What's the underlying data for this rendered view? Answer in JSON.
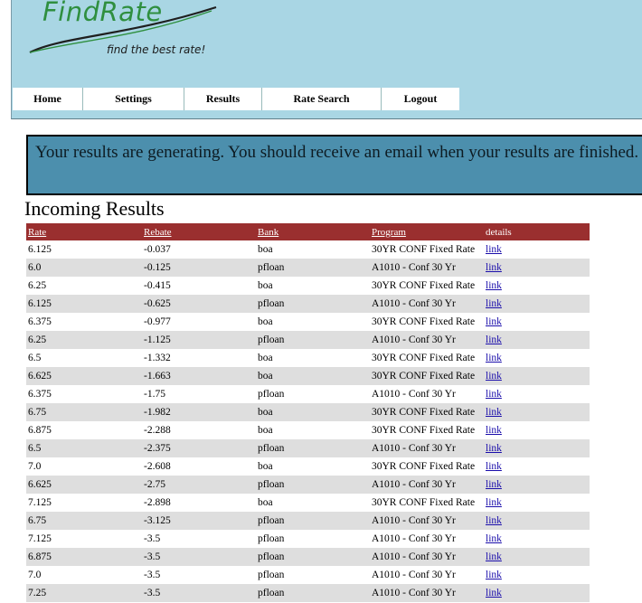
{
  "app": {
    "logo": "FindRate",
    "tagline": "find the best rate!"
  },
  "nav": {
    "items": [
      {
        "label": "Home"
      },
      {
        "label": "Settings"
      },
      {
        "label": "Results"
      },
      {
        "label": "Rate Search"
      },
      {
        "label": "Logout"
      }
    ]
  },
  "status": {
    "message": "Your results are generating. You should receive an email when your results are finished."
  },
  "section": {
    "title": "Incoming Results"
  },
  "table": {
    "headers": {
      "rate": "Rate",
      "rebate": "Rebate",
      "bank": "Bank",
      "program": "Program",
      "details": "details"
    },
    "rows": [
      {
        "rate": "6.125",
        "rebate": "-0.037",
        "bank": "boa",
        "program": "30YR CONF Fixed Rate",
        "details": "link"
      },
      {
        "rate": "6.0",
        "rebate": "-0.125",
        "bank": "pfloan",
        "program": "A1010 - Conf 30 Yr",
        "details": "link"
      },
      {
        "rate": "6.25",
        "rebate": "-0.415",
        "bank": "boa",
        "program": "30YR CONF Fixed Rate",
        "details": "link"
      },
      {
        "rate": "6.125",
        "rebate": "-0.625",
        "bank": "pfloan",
        "program": "A1010 - Conf 30 Yr",
        "details": "link"
      },
      {
        "rate": "6.375",
        "rebate": "-0.977",
        "bank": "boa",
        "program": "30YR CONF Fixed Rate",
        "details": "link"
      },
      {
        "rate": "6.25",
        "rebate": "-1.125",
        "bank": "pfloan",
        "program": "A1010 - Conf 30 Yr",
        "details": "link"
      },
      {
        "rate": "6.5",
        "rebate": "-1.332",
        "bank": "boa",
        "program": "30YR CONF Fixed Rate",
        "details": "link"
      },
      {
        "rate": "6.625",
        "rebate": "-1.663",
        "bank": "boa",
        "program": "30YR CONF Fixed Rate",
        "details": "link"
      },
      {
        "rate": "6.375",
        "rebate": "-1.75",
        "bank": "pfloan",
        "program": "A1010 - Conf 30 Yr",
        "details": "link"
      },
      {
        "rate": "6.75",
        "rebate": "-1.982",
        "bank": "boa",
        "program": "30YR CONF Fixed Rate",
        "details": "link"
      },
      {
        "rate": "6.875",
        "rebate": "-2.288",
        "bank": "boa",
        "program": "30YR CONF Fixed Rate",
        "details": "link"
      },
      {
        "rate": "6.5",
        "rebate": "-2.375",
        "bank": "pfloan",
        "program": "A1010 - Conf 30 Yr",
        "details": "link"
      },
      {
        "rate": "7.0",
        "rebate": "-2.608",
        "bank": "boa",
        "program": "30YR CONF Fixed Rate",
        "details": "link"
      },
      {
        "rate": "6.625",
        "rebate": "-2.75",
        "bank": "pfloan",
        "program": "A1010 - Conf 30 Yr",
        "details": "link"
      },
      {
        "rate": "7.125",
        "rebate": "-2.898",
        "bank": "boa",
        "program": "30YR CONF Fixed Rate",
        "details": "link"
      },
      {
        "rate": "6.75",
        "rebate": "-3.125",
        "bank": "pfloan",
        "program": "A1010 - Conf 30 Yr",
        "details": "link"
      },
      {
        "rate": "7.125",
        "rebate": "-3.5",
        "bank": "pfloan",
        "program": "A1010 - Conf 30 Yr",
        "details": "link"
      },
      {
        "rate": "6.875",
        "rebate": "-3.5",
        "bank": "pfloan",
        "program": "A1010 - Conf 30 Yr",
        "details": "link"
      },
      {
        "rate": "7.0",
        "rebate": "-3.5",
        "bank": "pfloan",
        "program": "A1010 - Conf 30 Yr",
        "details": "link"
      },
      {
        "rate": "7.25",
        "rebate": "-3.5",
        "bank": "pfloan",
        "program": "A1010 - Conf 30 Yr",
        "details": "link"
      }
    ]
  },
  "colors": {
    "header_bg": "#a9d6e4",
    "banner_bg": "#4c8fad",
    "table_header_bg": "#9a2f2f",
    "row_alt_bg": "#dedede",
    "logo": "#2f8f3f"
  }
}
